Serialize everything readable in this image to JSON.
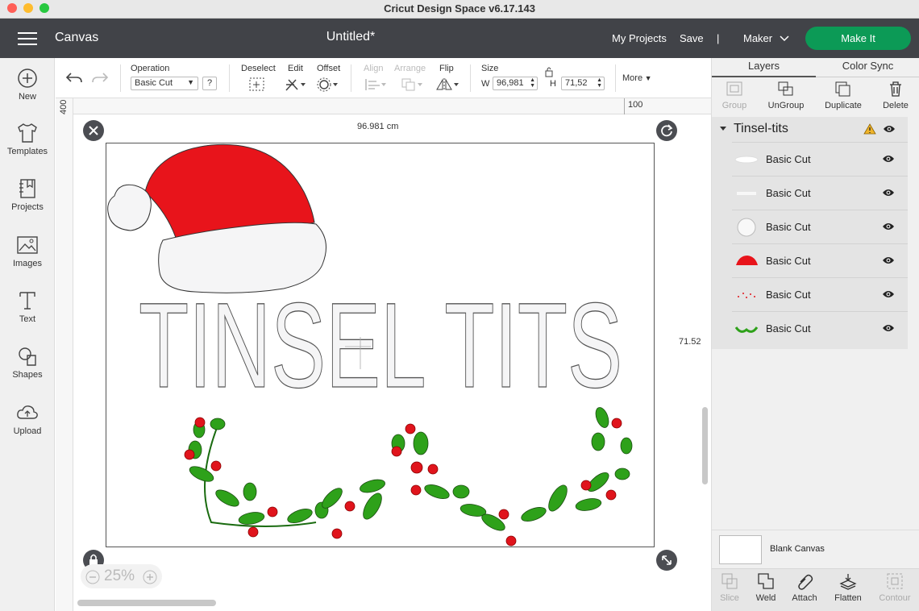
{
  "window": {
    "title": "Cricut Design Space  v6.17.143"
  },
  "header": {
    "section": "Canvas",
    "doc_title": "Untitled*",
    "my_projects": "My Projects",
    "save": "Save",
    "separator": "|",
    "machine": "Maker",
    "make_it": "Make It"
  },
  "sidebar": {
    "items": [
      {
        "label": "New",
        "icon": "plus-circle-icon"
      },
      {
        "label": "Templates",
        "icon": "tshirt-icon"
      },
      {
        "label": "Projects",
        "icon": "notebook-icon"
      },
      {
        "label": "Images",
        "icon": "image-icon"
      },
      {
        "label": "Text",
        "icon": "text-icon"
      },
      {
        "label": "Shapes",
        "icon": "shapes-icon"
      },
      {
        "label": "Upload",
        "icon": "cloud-upload-icon"
      }
    ]
  },
  "toolbar": {
    "operation_label": "Operation",
    "operation_value": "Basic Cut",
    "help": "?",
    "deselect": "Deselect",
    "edit": "Edit",
    "offset": "Offset",
    "align": "Align",
    "arrange": "Arrange",
    "flip": "Flip",
    "size": "Size",
    "w_label": "W",
    "w_value": "96,981",
    "h_label": "H",
    "h_value": "71,52",
    "more": "More"
  },
  "rulers": {
    "top_mark": "100",
    "left_mark": "400"
  },
  "canvas": {
    "width_readout": "96.981 cm",
    "height_readout": "71.52",
    "design_text": "TINSEL TITS",
    "zoom": "25%",
    "colors": {
      "hat_red": "#e8141b",
      "leaf_green": "#2ea11a",
      "berry_red": "#e0141c",
      "letter_fill": "#f5f5f6"
    }
  },
  "layers_panel": {
    "tabs": [
      "Layers",
      "Color Sync"
    ],
    "actions": [
      {
        "label": "Group",
        "enabled": false
      },
      {
        "label": "UnGroup",
        "enabled": true
      },
      {
        "label": "Duplicate",
        "enabled": true
      },
      {
        "label": "Delete",
        "enabled": true
      }
    ],
    "group_name": "Tinsel-tits",
    "layers": [
      {
        "name": "Basic Cut",
        "thumb": "white-shape"
      },
      {
        "name": "Basic Cut",
        "thumb": "white-text"
      },
      {
        "name": "Basic Cut",
        "thumb": "white-pompom"
      },
      {
        "name": "Basic Cut",
        "thumb": "red-hat"
      },
      {
        "name": "Basic Cut",
        "thumb": "red-berries"
      },
      {
        "name": "Basic Cut",
        "thumb": "green-leaves"
      }
    ],
    "blank_canvas": "Blank Canvas",
    "bottom_actions": [
      {
        "label": "Slice",
        "enabled": false
      },
      {
        "label": "Weld",
        "enabled": true
      },
      {
        "label": "Attach",
        "enabled": true
      },
      {
        "label": "Flatten",
        "enabled": true
      },
      {
        "label": "Contour",
        "enabled": false
      }
    ]
  }
}
